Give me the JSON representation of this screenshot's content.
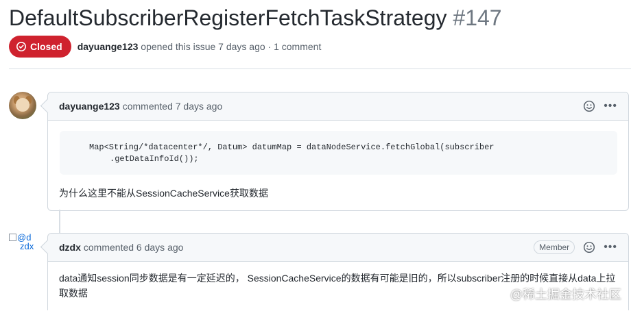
{
  "issue": {
    "title": "DefaultSubscriberRegisterFetchTaskStrategy",
    "number": "#147",
    "state": "Closed",
    "author": "dayuange123",
    "meta_text": " opened this issue 7 days ago · 1 comment"
  },
  "comments": [
    {
      "author": "dayuange123",
      "time_text": "commented 7 days ago",
      "code_line1": "Map<String/*datacenter*/, Datum> datumMap = dataNodeService.fetchGlobal(subscriber",
      "code_line2": ".getDataInfoId());",
      "body": "为什么这里不能从SessionCacheService获取数据"
    },
    {
      "author": "dzdx",
      "avatar_alt": "@dzdx",
      "avatar_alt_top": "@d",
      "avatar_alt_bottom": "zdx",
      "time_text": "commented 6 days ago",
      "badge": "Member",
      "body": "data通知session同步数据是有一定延迟的， SessionCacheService的数据有可能是旧的，所以subscriber注册的时候直接从data上拉取数据"
    }
  ],
  "watermark": "@稀土掘金技术社区",
  "icons": {
    "closed_state": "issue-closed-icon",
    "reaction": "smiley-icon",
    "more": "kebab-horizontal-icon"
  },
  "colors": {
    "closed_badge": "#cf222e",
    "link": "#0969da",
    "header_bg": "#f6f8fa"
  }
}
